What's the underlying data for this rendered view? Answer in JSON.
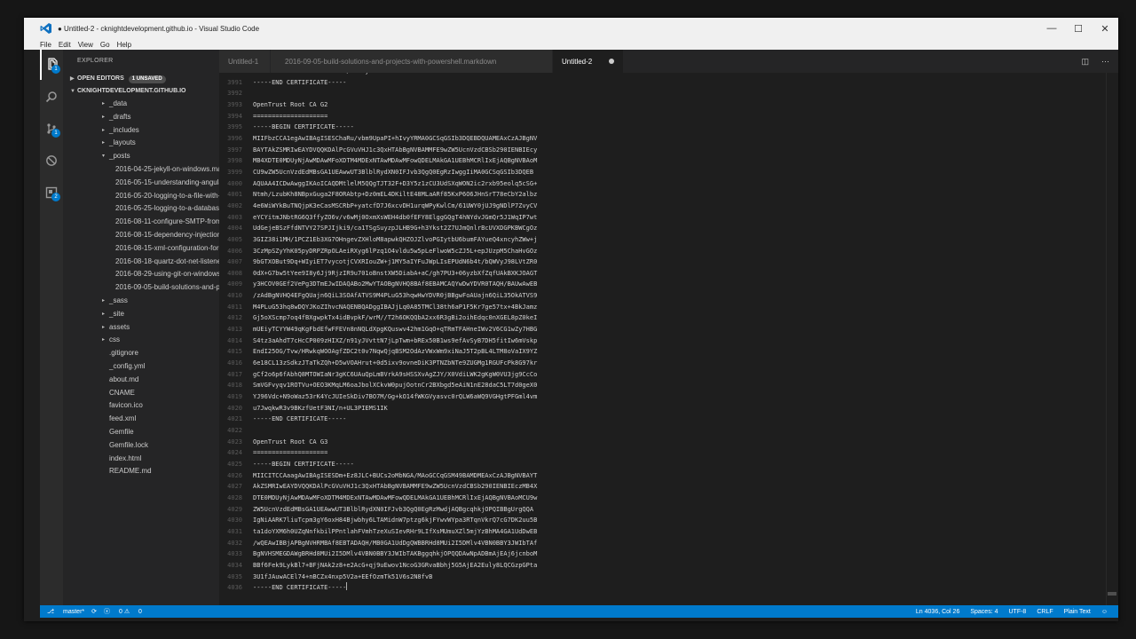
{
  "window": {
    "title": "● Untitled-2 - cknightdevelopment.github.io - Visual Studio Code",
    "controls": [
      "—",
      "☐",
      "✕"
    ]
  },
  "menu": [
    "File",
    "Edit",
    "View",
    "Go",
    "Help"
  ],
  "activity_bar": [
    {
      "icon": "files-icon",
      "badge": "1"
    },
    {
      "icon": "search-icon",
      "badge": ""
    },
    {
      "icon": "git-icon",
      "badge": "1"
    },
    {
      "icon": "debug-icon",
      "badge": ""
    },
    {
      "icon": "extensions-icon",
      "badge": "2"
    }
  ],
  "sidebar": {
    "title": "EXPLORER",
    "open_editors_label": "OPEN EDITORS",
    "open_editors_badge": "1 UNSAVED",
    "project_label": "CKNIGHTDEVELOPMENT.GITHUB.IO",
    "tree": [
      {
        "label": "_data",
        "type": "folder",
        "indent": 1
      },
      {
        "label": "_drafts",
        "type": "folder",
        "indent": 1
      },
      {
        "label": "_includes",
        "type": "folder",
        "indent": 1
      },
      {
        "label": "_layouts",
        "type": "folder",
        "indent": 1
      },
      {
        "label": "_posts",
        "type": "open-folder",
        "indent": 1
      },
      {
        "label": "2016-04-25-jekyll-on-windows.markdown",
        "type": "file",
        "indent": 2
      },
      {
        "label": "2016-05-15-understanding-angular-d",
        "type": "file",
        "indent": 2
      },
      {
        "label": "2016-05-20-logging-to-a-file-with-nl",
        "type": "file",
        "indent": 2
      },
      {
        "label": "2016-05-25-logging-to-a-database-w",
        "type": "file",
        "indent": 2
      },
      {
        "label": "2016-08-11-configure-SMTP-from-co",
        "type": "file",
        "indent": 2
      },
      {
        "label": "2016-08-15-dependency-injection-fo",
        "type": "file",
        "indent": 2
      },
      {
        "label": "2016-08-15-xml-configuration-for-qu",
        "type": "file",
        "indent": 2
      },
      {
        "label": "2016-08-18-quartz-dot-net-listeners.",
        "type": "file",
        "indent": 2
      },
      {
        "label": "2016-08-29-using-git-on-windows-y",
        "type": "file",
        "indent": 2
      },
      {
        "label": "2016-09-05-build-solutions-and-proj",
        "type": "file",
        "indent": 2
      },
      {
        "label": "_sass",
        "type": "folder",
        "indent": 1
      },
      {
        "label": "_site",
        "type": "folder",
        "indent": 1
      },
      {
        "label": "assets",
        "type": "folder",
        "indent": 1
      },
      {
        "label": "css",
        "type": "folder",
        "indent": 1
      },
      {
        "label": ".gitignore",
        "type": "file",
        "indent": 1
      },
      {
        "label": "_config.yml",
        "type": "file",
        "indent": 1
      },
      {
        "label": "about.md",
        "type": "file",
        "indent": 1
      },
      {
        "label": "CNAME",
        "type": "file",
        "indent": 1
      },
      {
        "label": "favicon.ico",
        "type": "file",
        "indent": 1
      },
      {
        "label": "feed.xml",
        "type": "file",
        "indent": 1
      },
      {
        "label": "Gemfile",
        "type": "file",
        "indent": 1
      },
      {
        "label": "Gemfile.lock",
        "type": "file",
        "indent": 1
      },
      {
        "label": "index.html",
        "type": "file",
        "indent": 1
      },
      {
        "label": "README.md",
        "type": "file",
        "indent": 1
      }
    ]
  },
  "tabs": [
    {
      "label": "Untitled-1",
      "active": false
    },
    {
      "label": "2016-09-05-build-solutions-and-projects-with-powershell.markdown",
      "active": false
    },
    {
      "label": "Untitled-2",
      "active": true
    }
  ],
  "editor": {
    "lines": [
      {
        "n": "",
        "t": "UXdDLbECB97W4EUH1b5G5N5EN/WK0YjDXx"
      },
      {
        "n": "3991",
        "t": "-----END CERTIFICATE-----"
      },
      {
        "n": "3992",
        "t": ""
      },
      {
        "n": "3993",
        "t": "OpenTrust Root CA G2"
      },
      {
        "n": "3994",
        "t": "===================="
      },
      {
        "n": "3995",
        "t": "-----BEGIN CERTIFICATE-----"
      },
      {
        "n": "3996",
        "t": "MIIFbzCCA1egAwIBAgISESChaRu/vbm9UpaPI+hIvyYRMA0GCSqGSIb3DQEBDQUAMEAxCzAJBgNV"
      },
      {
        "n": "3997",
        "t": "BAYTAkZSMRIwEAYDVQQKDAlPcGVuVHJ1c3QxHTAbBgNVBAMMFE9wZW5UcnVzdCBSb290IENBIEcy"
      },
      {
        "n": "3998",
        "t": "MB4XDTE0MDUyNjAwMDAwMFoXDTM4MDExNTAwMDAwMFowQDELMAkGA1UEBhMCRlIxEjAQBgNVBAoM"
      },
      {
        "n": "3999",
        "t": "CU9wZW5UcnVzdEdMBsGA1UEAwwUT3BlblRydXN0IFJvb3QgQ0EgRzIwggIiMA0GCSqGSIb3DQEB"
      },
      {
        "n": "4000",
        "t": "AQUAA4ICDwAwggIKAoICAQDMtlelM5QQgTJT32F+D3Y5z1zCU3UdSXqWON2ic2rxb95eolq5cSG+"
      },
      {
        "n": "4001",
        "t": "Ntmh/LzubKh8NBpxGuga2F8ORAbtp+Dz0mEL4DKiltE48MLaARf85KxP6O6JHnSrT78eCbY2albz"
      },
      {
        "n": "4002",
        "t": "4e6WiWYkBuTNQjpK3eCasMSCRbP+yatcfD7J6xcvDH1urqWPyKwlCm/61UWY0jUJ9gNDlP7ZvyCV"
      },
      {
        "n": "4003",
        "t": "eYCYitmJNbtRG6Q3ffyZO6v/v6wMj0OxmXsWEH4db0fEFY8ElggGQgT4hNYdvJGmQr5J1WqIP7wt"
      },
      {
        "n": "4004",
        "t": "UdGejeBSzFfdNTVY27SPJIjki9/ca1TSgSuyzpJLHB9G+h3Ykst2Z7UJmQnlrBcUVXDGPKBWCgOz"
      },
      {
        "n": "4005",
        "t": "3GIZ38i1MH/1PCZ1Eb3XG7OHngevZXHloM8apwkQHZOJZlvoPGIytbU6bumFAYueQ4xncyhZWw+j"
      },
      {
        "n": "4006",
        "t": "3CzMpSZyYhK05pyDRPZRpOLAeiRXyg6lPzq1O4vldu5w5pLeFlwoW5cZJ5L+epJUzpM5ChaHvGOz"
      },
      {
        "n": "4007",
        "t": "9bGTXOBut9Dq+WIyiET7vycotjCVXRIouZW+j1MY5aIYFuJWpLIsEPUdN6b4t/bQWVyJ98LVtZR0"
      },
      {
        "n": "4008",
        "t": "0dX+G7bw5tYee9I8y6Jj9RjzIR9u701oBnstXW5DiabA+aC/gh7PU3+06yzbXfZqfUAkBXKJOAGT"
      },
      {
        "n": "4009",
        "t": "y3HCOV0GEf2VePg3DTmEJwIDAQABo2MwYTAOBgNVHQ8BAf8EBAMCAQYwDwYDVR0TAQH/BAUwAwEB"
      },
      {
        "n": "4010",
        "t": "/zAdBgNVHQ4EFgQUajn6QiL3SOAfATVS9M4PLuG53hqwHwYDVR0jBBgwFoAUajn6QiL35OkATVS9"
      },
      {
        "n": "4011",
        "t": "M4PLuG53hq8wDQYJKoZIhvcNAQENBQADggIBAJjLq0A85TMCl38th6aP1F5Kr7ge57tx+4BkJamz"
      },
      {
        "n": "4012",
        "t": "Gj5oXScmp7oq4fBXgwpkTx4idBvpkF/wrM//T2h6OKQQbA2xx6R3gBi2oihEdqc0nXGEL8pZ0keI"
      },
      {
        "n": "4013",
        "t": "mUEiyTCYYW49qKgFbdEfwFFEVn8nNQLdXpgKQuswv42hm1GqO+qTRmTFAHneIWv2V6CG1wZy7HBG"
      },
      {
        "n": "4014",
        "t": "S4tz3aAhdT7cHcCP009zHIXZ/n91yJVvttN7jLpTwm+bREx50B1ws9efAvSyB7DH5fitIw6mVskp"
      },
      {
        "n": "4015",
        "t": "EndI25OG/Tvw/HRwkqWOOAgfZDC2t0v7NqwQjqBSM2OdAzVWxWm9xiNaJ5T2pBL4LTM8oVaIX9YZ"
      },
      {
        "n": "4016",
        "t": "6e18CL13zSdkzJTaTkZQh+D5wVOAHrut+0d5ixv9ovneDiK3PTNZbNTe9ZUGMg1RGUFcPk8G97kr"
      },
      {
        "n": "4017",
        "t": "gCf2o6p6fAbhQ8MTOWIaNr3gKC6UAuQpLmBVrkA9sHSSXvAgZJY/X0VdiLWK2gKgW0VU3jg9CcCo"
      },
      {
        "n": "4018",
        "t": "SmVGFvyqv1ROTVu+OEO3KMqLM6oaJbolXCkvW0pujOotnCr2BXbgd5eAiN1nE28daC5LT7d0geX0"
      },
      {
        "n": "4019",
        "t": "YJ96Vdc+N9oWaz53rK4YcJUIeSkDiv7BO7M/Gg+kO14fWKGVyasvc0rQLW6aWQ9VGHgtPFGml4vm"
      },
      {
        "n": "4020",
        "t": "u7JwqkwR3v9BKzfUetF3NI/n+UL3PIEMS1IK"
      },
      {
        "n": "4021",
        "t": "-----END CERTIFICATE-----"
      },
      {
        "n": "4022",
        "t": ""
      },
      {
        "n": "4023",
        "t": "OpenTrust Root CA G3"
      },
      {
        "n": "4024",
        "t": "===================="
      },
      {
        "n": "4025",
        "t": "-----BEGIN CERTIFICATE-----"
      },
      {
        "n": "4026",
        "t": "MIICITCCAaagAwIBAgISESDm+Ez8JLC+BUCs2oMbNGA/MAoGCCqGSM49BAMDMEAxCzAJBgNVBAYT"
      },
      {
        "n": "4027",
        "t": "AkZSMRIwEAYDVQQKDAlPcGVuVHJ1c3QxHTAbBgNVBAMMFE9wZW5UcnVzdCBSb290IENBIEczMB4X"
      },
      {
        "n": "4028",
        "t": "DTE0MDUyNjAwMDAwMFoXDTM4MDExNTAwMDAwMFowQDELMAkGA1UEBhMCRlIxEjAQBgNVBAoMCU9w"
      },
      {
        "n": "4029",
        "t": "ZW5UcnVzdEdMBsGA1UEAwwUT3BlblRydXN0IFJvb3QgQ0EgRzMwdjAQBgcqhkjOPQIBBgUrgQQA"
      },
      {
        "n": "4030",
        "t": "IgNiAARK7liuTcpm3gY6oxH84Bjwbhy6LTAMidnW7ptzg6kjFYwvWYpa3RTqnVkrQ7cG7DK2uu5B"
      },
      {
        "n": "4031",
        "t": "ta1doYXM6h0UZqNnfkbilPPntlahFVmhTzeXuSIevRHr9LIfXsMUmuXZl5mjYzBhMA4GA1UdDwEB"
      },
      {
        "n": "4032",
        "t": "/wQEAwIBBjAPBgNVHRMBAf8EBTADAQH/MB0GA1UdDgQWBBRHd8MUi2I5DMlv4VBN0BBY3JWIbTAf"
      },
      {
        "n": "4033",
        "t": "BgNVHSMEGDAWgBRHd8MUi2I5DMlv4VBN0BBY3JWIbTAKBggqhkjOPQQDAwNpADBmAjEAj6jcnboM"
      },
      {
        "n": "4034",
        "t": "BBf6Fek9LykBl7+BFjNAk2z8+e2AcG+qj9uEwov1NcoG3GRvaBbhj5G5AjEA2Euly8LQCGzpGPta"
      },
      {
        "n": "4035",
        "t": "3U1fJAuwACEl74+nBCZx4nxp5V2a+EEfOzmTk51V6s2N8fvB"
      },
      {
        "n": "4036",
        "t": "-----END CERTIFICATE-----"
      }
    ]
  },
  "status": {
    "branch": "master*",
    "sync_icon": "sync-icon",
    "errors": "0",
    "warnings": "0",
    "position": "Ln 4036, Col 26",
    "indent": "Spaces: 4",
    "encoding": "UTF-8",
    "eol": "CRLF",
    "language": "Plain Text"
  }
}
